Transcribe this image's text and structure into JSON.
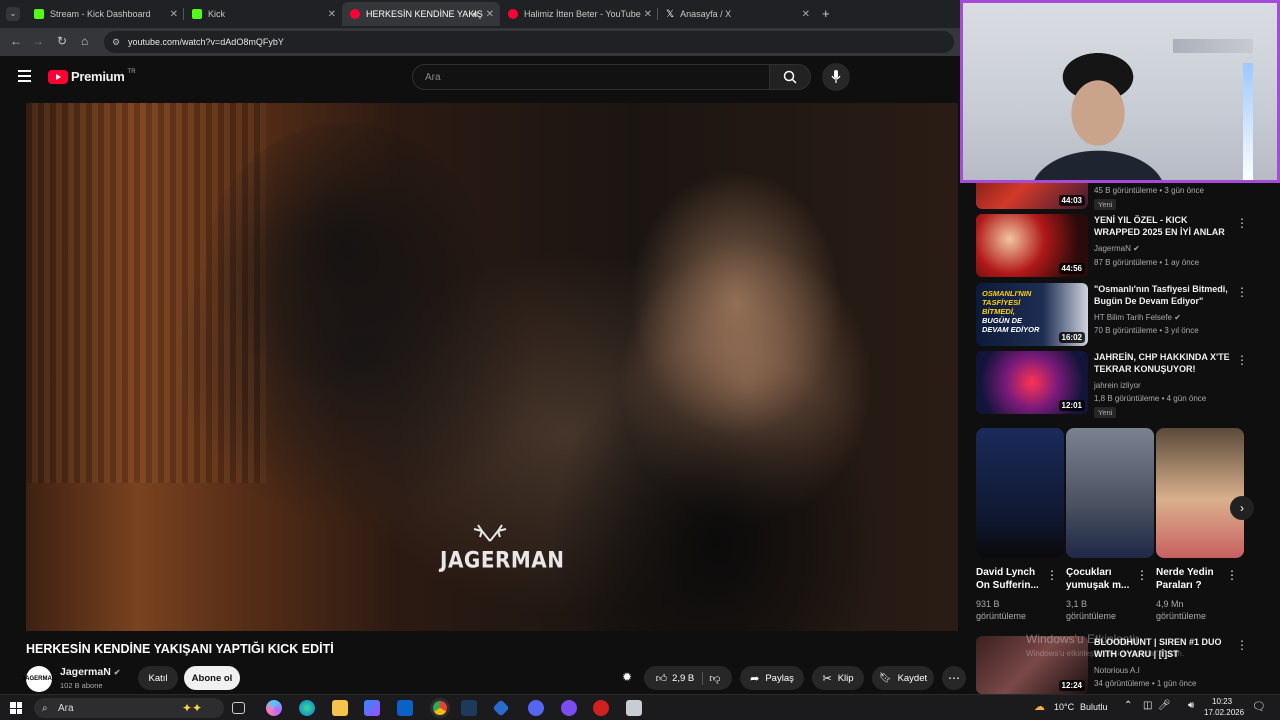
{
  "browser": {
    "tabs": [
      {
        "label": "Stream - Kick Dashboard",
        "favicon_color": "#53fc18"
      },
      {
        "label": "Kick",
        "favicon_color": "#53fc18"
      },
      {
        "label": "HERKESİN KENDİNE YAKIŞ",
        "favicon_color": "#ff0033",
        "active": true
      },
      {
        "label": "Halimiz İtten Beter - YouTube",
        "favicon_color": "#ff0033"
      },
      {
        "label": "Anasayfa / X",
        "favicon_color": "#ffffff"
      }
    ],
    "new_tab": "+",
    "url": "youtube.com/watch?v=dAdO8mQFybY"
  },
  "yt": {
    "logo_text": "Premium",
    "region": "TR",
    "search_placeholder": "Ara"
  },
  "video": {
    "watermark_text": "JAGERMAN",
    "title": "HERKESİN KENDİNE YAKIŞANI YAPTIĞI KICK EDİTİ",
    "channel": {
      "name": "JagermaN",
      "subscribers": "102 B abone",
      "avatar_text": "JAGERMAN"
    },
    "join_label": "Katıl",
    "subscribe_label": "Abone ol",
    "likes": "2,9 B",
    "share_label": "Paylaş",
    "clip_label": "Klip",
    "save_label": "Kaydet"
  },
  "recommendations": [
    {
      "title": "",
      "channel": "",
      "meta": "45 B görüntüleme • 3 gün önce",
      "duration": "44:03",
      "badge": "Yeni",
      "verified": false
    },
    {
      "title": "YENİ YIL ÖZEL - KICK WRAPPED 2025 EN İYİ ANLAR",
      "channel": "JagermaN",
      "meta": "87 B görüntüleme • 1 ay önce",
      "duration": "44:56",
      "badge": "",
      "verified": true
    },
    {
      "title": "\"Osmanlı'nın Tasfiyesi Bitmedi, Bugün De Devam Ediyor\"",
      "channel": "HT Bilim Tarih Felsefe",
      "meta": "70 B görüntüleme • 3 yıl önce",
      "duration": "16:02",
      "badge": "",
      "verified": true,
      "thumb_text": [
        "OSMANLI'NIN",
        "TASFİYESİ",
        "BİTMEDİ,",
        "BUGÜN DE",
        "DEVAM EDİYOR"
      ]
    },
    {
      "title": "JAHREİN, CHP HAKKINDA X'TE TEKRAR KONUŞUYOR!",
      "channel": "jahrein izliyor",
      "meta": "1,8 B görüntüleme • 4 gün önce",
      "duration": "12:01",
      "badge": "Yeni",
      "verified": false
    },
    {
      "title": "BLOODHUNT | SIREN #1 DUO WITH OYARU | [İ]ST",
      "channel": "Notorious A.I",
      "meta": "34 görüntüleme • 1 gün önce",
      "duration": "12:24",
      "badge": "",
      "verified": false
    }
  ],
  "shorts": [
    {
      "title": "David Lynch On Sufferin...",
      "views": "931 B",
      "views_label": "görüntüleme"
    },
    {
      "title": "Çocukları yumuşak m...",
      "views": "3,1 B",
      "views_label": "görüntüleme"
    },
    {
      "title": "Nerde Yedin Paraları ?",
      "views": "4,9 Mn",
      "views_label": "görüntüleme"
    }
  ],
  "windows_watermark": {
    "line1": "Windows'u Etkinleştir",
    "line2": "Windows'u etkinleştirmek için Ayarlar'a gidin."
  },
  "taskbar": {
    "search_label": "Ara",
    "weather": "10°C",
    "weather_desc": "Bulutlu",
    "time": "10:23",
    "date": "17.02.2026"
  },
  "colors": {
    "youtube_red": "#ff0033",
    "kick_green": "#53fc18",
    "cam_border": "#a64bd6"
  }
}
